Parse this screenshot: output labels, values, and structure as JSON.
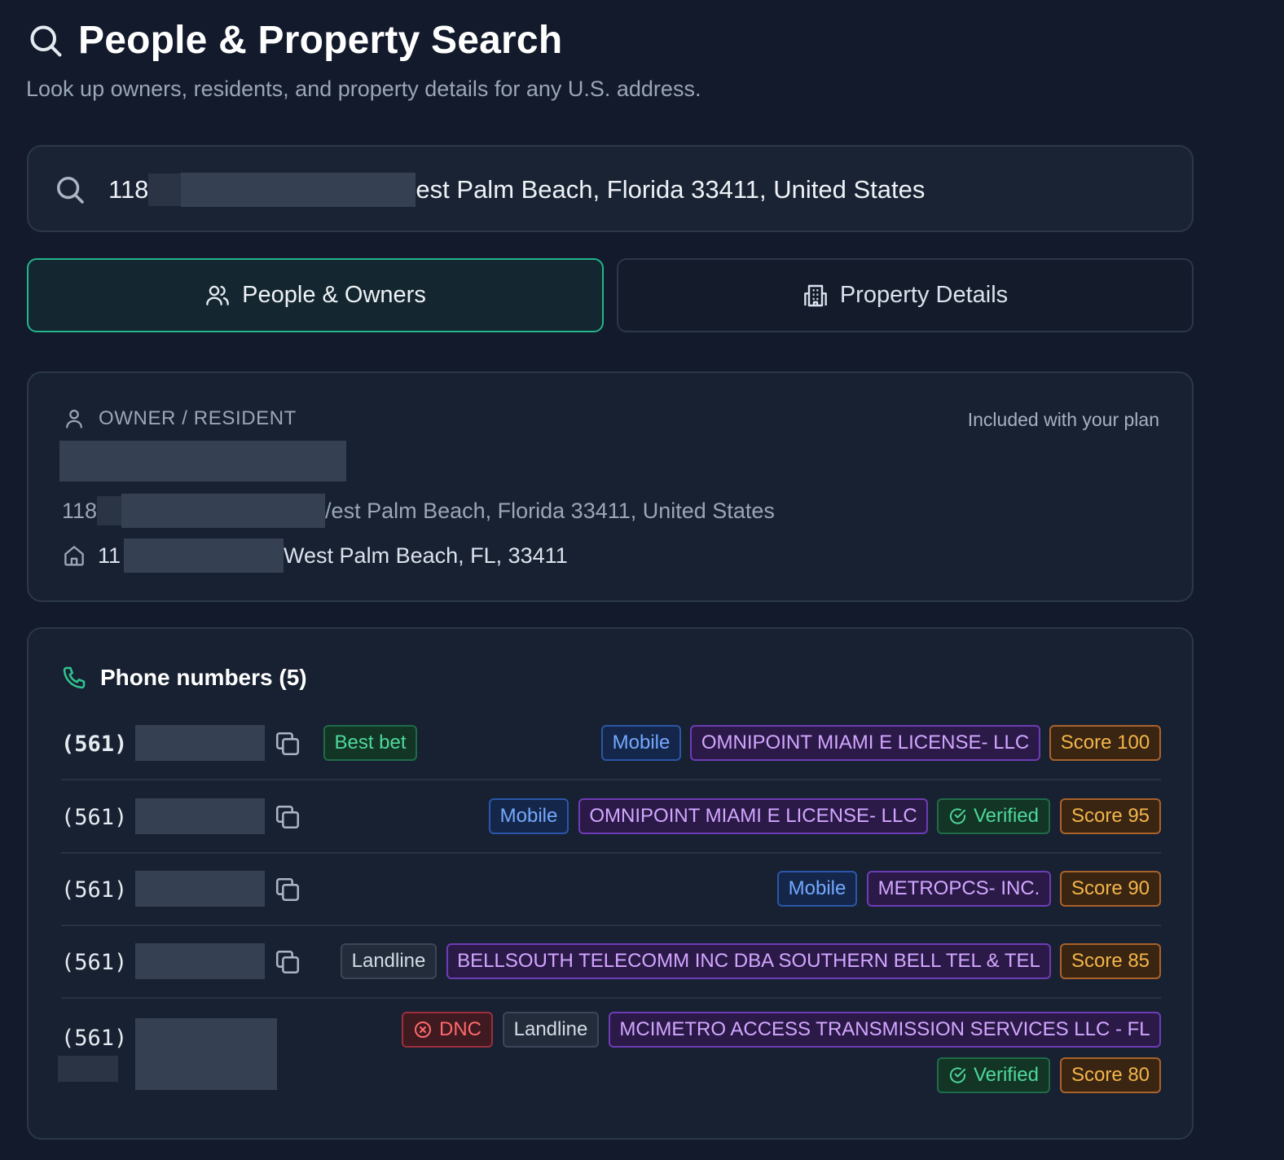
{
  "header": {
    "title": "People & Property Search",
    "subtitle": "Look up owners, residents, and property details for any U.S. address."
  },
  "search": {
    "value_prefix": "118",
    "value_suffix": "est Palm Beach, Florida 33411, United States"
  },
  "tabs": [
    {
      "label": "People & Owners",
      "active": true
    },
    {
      "label": "Property Details",
      "active": false
    }
  ],
  "owner_card": {
    "label": "OWNER / RESIDENT",
    "plan_note": "Included with your plan",
    "address_prefix": "118",
    "address_suffix": "/est Palm Beach, Florida 33411, United States",
    "home_prefix": "11",
    "home_suffix": "West Palm Beach, FL, 33411"
  },
  "phones": {
    "title": "Phone numbers (5)",
    "items": [
      {
        "area": "(561)",
        "best_bet": "Best bet",
        "type": "Mobile",
        "carrier": "OMNIPOINT MIAMI E LICENSE- LLC",
        "score": "Score 100"
      },
      {
        "area": "(561)",
        "type": "Mobile",
        "carrier": "OMNIPOINT MIAMI E LICENSE- LLC",
        "verified": "Verified",
        "score": "Score 95"
      },
      {
        "area": "(561)",
        "type": "Mobile",
        "carrier": "METROPCS- INC.",
        "score": "Score 90"
      },
      {
        "area": "(561)",
        "type": "Landline",
        "carrier": "BELLSOUTH TELECOMM INC DBA SOUTHERN BELL TEL & TEL",
        "score": "Score 85"
      },
      {
        "area": "(561)",
        "dnc": "DNC",
        "type": "Landline",
        "carrier": "MCIMETRO ACCESS TRANSMISSION SERVICES LLC - FL",
        "verified": "Verified",
        "score": "Score 80"
      }
    ]
  },
  "colors": {
    "accent": "#22b58a",
    "background": "#121a2b",
    "card": "#182132"
  }
}
